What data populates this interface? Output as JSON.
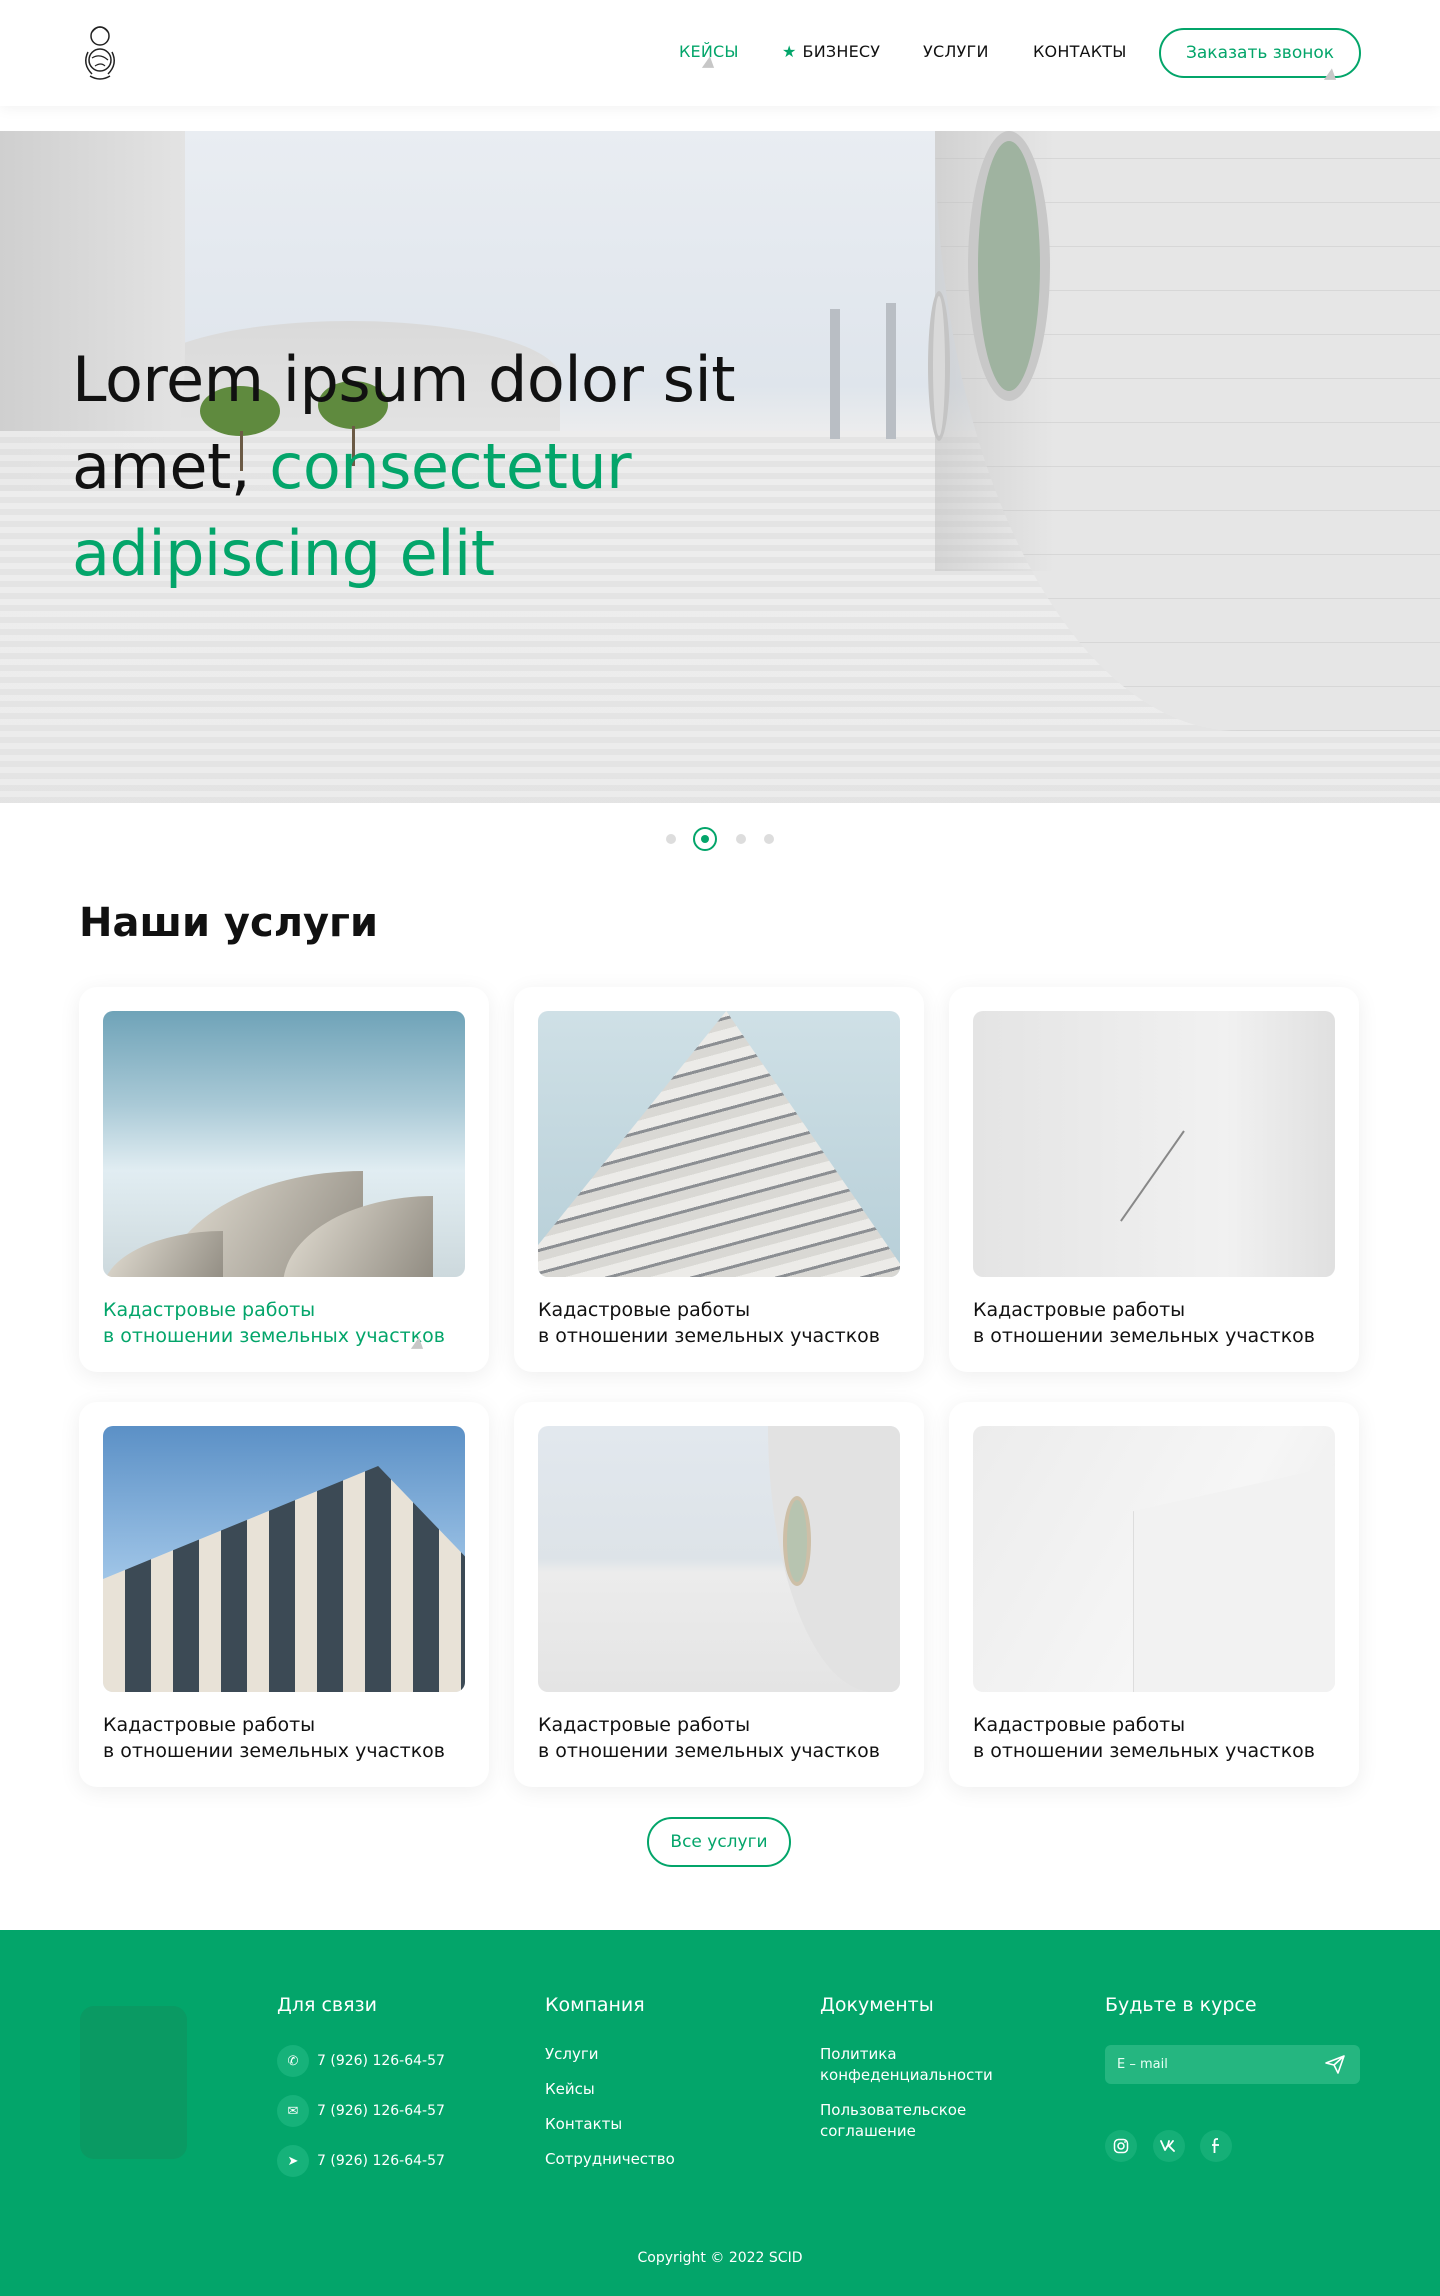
{
  "header": {
    "nav": [
      {
        "label": "КЕЙСЫ"
      },
      {
        "label": "БИЗНЕСУ"
      },
      {
        "label": "УСЛУГИ"
      },
      {
        "label": "КОНТАКТЫ"
      }
    ],
    "cta_label": "Заказать звонок",
    "accent_color": "#03a56a"
  },
  "hero": {
    "title_part1": "Lorem ipsum dolor sit amet, ",
    "title_accent": "consectetur adipiscing elit",
    "slides_total": 4,
    "active_slide": 2
  },
  "services": {
    "title": "Наши услуги",
    "cards": [
      {
        "title_line1": "Кадастровые работы",
        "title_line2": "в отношении земельных участков"
      },
      {
        "title_line1": "Кадастровые работы",
        "title_line2": "в отношении земельных участков"
      },
      {
        "title_line1": "Кадастровые работы",
        "title_line2": "в отношении земельных участков"
      },
      {
        "title_line1": "Кадастровые работы",
        "title_line2": "в отношении земельных участков"
      },
      {
        "title_line1": "Кадастровые работы",
        "title_line2": "в отношении земельных участков"
      },
      {
        "title_line1": "Кадастровые работы",
        "title_line2": "в отношении земельных участков"
      }
    ],
    "all_button": "Все услуги"
  },
  "footer": {
    "contact_title": "Для связи",
    "phones": [
      {
        "icon": "whatsapp-icon",
        "text": "7 (926) 126-64-57"
      },
      {
        "icon": "mail-icon",
        "text": "7 (926) 126-64-57"
      },
      {
        "icon": "telegram-icon",
        "text": "7 (926) 126-64-57"
      }
    ],
    "company_title": "Компания",
    "company_links": [
      "Услуги",
      "Кейсы",
      "Контакты",
      "Сотрудничество"
    ],
    "docs_title": "Документы",
    "docs_links": [
      {
        "line1": "Политика",
        "line2": "конфеденциальности"
      },
      {
        "line1": "Пользовательское",
        "line2": "соглашение"
      }
    ],
    "subscribe_title": "Будьте в курсе",
    "email_placeholder": "E – mail",
    "socials": [
      "instagram-icon",
      "vk-icon",
      "facebook-icon"
    ],
    "copyright": "Copyright © 2022 SCID"
  }
}
